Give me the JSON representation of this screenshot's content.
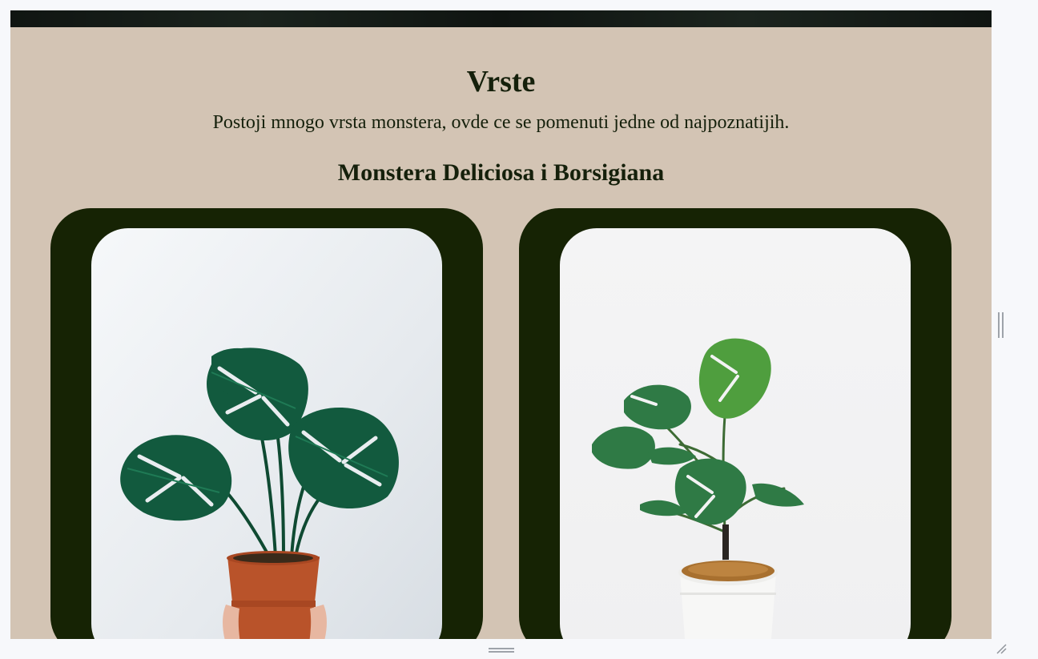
{
  "section": {
    "title": "Vrste",
    "subtitle": "Postoji mnogo vrsta monstera, ovde ce se pomenuti jedne od najpoznatijih."
  },
  "subsection": {
    "title": "Monstera Deliciosa i Borsigiana"
  },
  "cards": [
    {
      "image": "monstera-deliciosa-photo"
    },
    {
      "image": "monstera-borsigiana-photo"
    }
  ],
  "colors": {
    "background": "#d3c4b4",
    "card": "#162304",
    "text": "#15200b"
  }
}
